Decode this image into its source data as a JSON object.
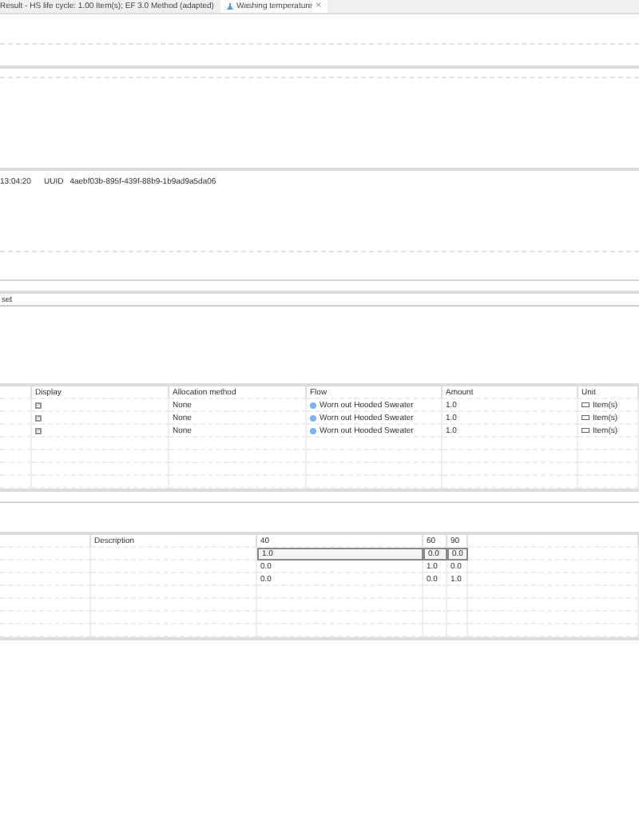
{
  "tabs": [
    {
      "label": "Result - HS life cycle: 1.00 Item(s); EF 3.0 Method (adapted)",
      "selected": false
    },
    {
      "label": "Washing temperature",
      "selected": true,
      "close": "×"
    }
  ],
  "info": {
    "time": "13:04:20",
    "uuid_label": "UUID",
    "uuid": "4aebf03b-895f-439f-88b9-1b9ad9a5da06"
  },
  "section_label": "set",
  "allocation_table": {
    "columns": [
      "Display",
      "Allocation method",
      "Flow",
      "Amount",
      "Unit"
    ],
    "rows": [
      {
        "checked": true,
        "method": "None",
        "flow": "Worn out Hooded Sweater",
        "amount": "1.0",
        "unit": "Item(s)"
      },
      {
        "checked": true,
        "method": "None",
        "flow": "Worn out Hooded Sweater",
        "amount": "1.0",
        "unit": "Item(s)"
      },
      {
        "checked": true,
        "method": "None",
        "flow": "Worn out Hooded Sweater",
        "amount": "1.0",
        "unit": "Item(s)"
      }
    ]
  },
  "factor_table": {
    "columns": [
      "Description",
      "40",
      "60",
      "90"
    ],
    "rows": [
      {
        "selected": true,
        "values": [
          "1.0",
          "0.0",
          "0.0"
        ]
      },
      {
        "selected": false,
        "values": [
          "0.0",
          "1.0",
          "0.0"
        ]
      },
      {
        "selected": false,
        "values": [
          "0.0",
          "0.0",
          "1.0"
        ]
      }
    ]
  }
}
